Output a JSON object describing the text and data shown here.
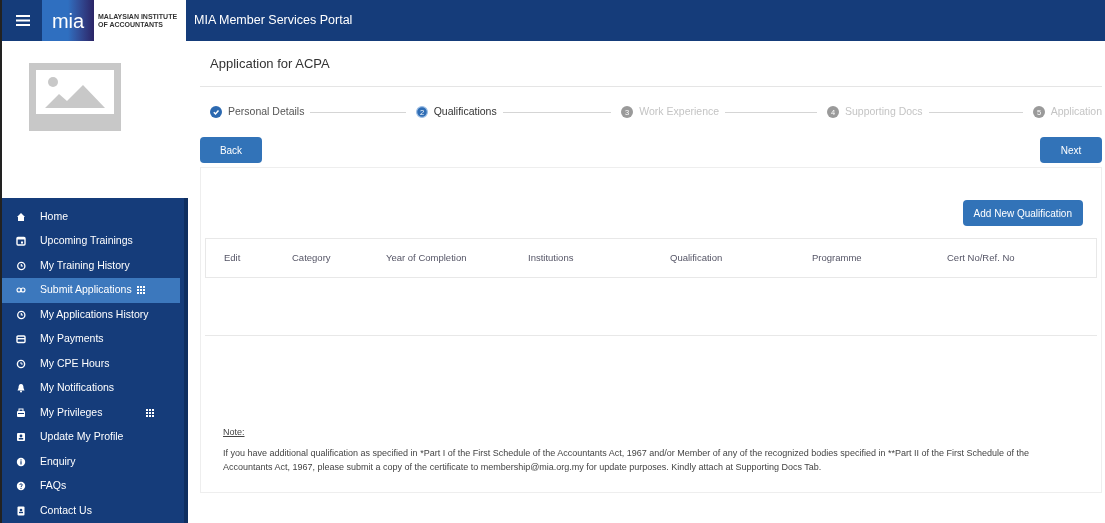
{
  "header": {
    "logo_text": "mia",
    "logo_caption": "MALAYSIAN INSTITUTE\nOF ACCOUNTANTS",
    "title": "MIA Member Services Portal"
  },
  "sidebar": {
    "items": [
      {
        "label": "Home",
        "selected": false,
        "submenu": false
      },
      {
        "label": "Upcoming Trainings",
        "selected": false,
        "submenu": false
      },
      {
        "label": "My Training History",
        "selected": false,
        "submenu": false
      },
      {
        "label": "Submit Applications",
        "selected": true,
        "submenu": true
      },
      {
        "label": "My Applications History",
        "selected": false,
        "submenu": false
      },
      {
        "label": "My Payments",
        "selected": false,
        "submenu": false
      },
      {
        "label": "My CPE Hours",
        "selected": false,
        "submenu": false
      },
      {
        "label": "My Notifications",
        "selected": false,
        "submenu": false
      },
      {
        "label": "My Privileges",
        "selected": false,
        "submenu": true
      },
      {
        "label": "Update My Profile",
        "selected": false,
        "submenu": false
      },
      {
        "label": "Enquiry",
        "selected": false,
        "submenu": false
      },
      {
        "label": "FAQs",
        "selected": false,
        "submenu": false
      },
      {
        "label": "Contact Us",
        "selected": false,
        "submenu": false
      }
    ]
  },
  "page_title": "Application for ACPA",
  "steps": [
    {
      "label": "Personal Details",
      "completed": true,
      "selected": false
    },
    {
      "number": "2",
      "label": "Qualifications",
      "completed": false,
      "selected": true
    },
    {
      "number": "3",
      "label": "Work Experience",
      "completed": false,
      "selected": false
    },
    {
      "number": "4",
      "label": "Supporting Docs",
      "completed": false,
      "selected": false
    },
    {
      "number": "5",
      "label": "Application",
      "completed": false,
      "selected": false
    }
  ],
  "back_button": "Back",
  "next_button": "Next",
  "add_button": "Add New Qualification",
  "table": {
    "columns": [
      "Edit",
      "Category",
      "Year of Completion",
      "Institutions",
      "Qualification",
      "Programme",
      "Cert No/Ref. No"
    ]
  },
  "note": {
    "heading": "Note:",
    "text": "If you have additional qualification as specified in *Part I of the First Schedule of the Accountants Act, 1967 and/or Member of any of the recognized bodies specified in **Part II of the First Schedule of the Accountants Act, 1967, please submit a copy of the certificate to membership@mia.org.my for update purposes. Kindly attach at Supporting Docs Tab."
  }
}
